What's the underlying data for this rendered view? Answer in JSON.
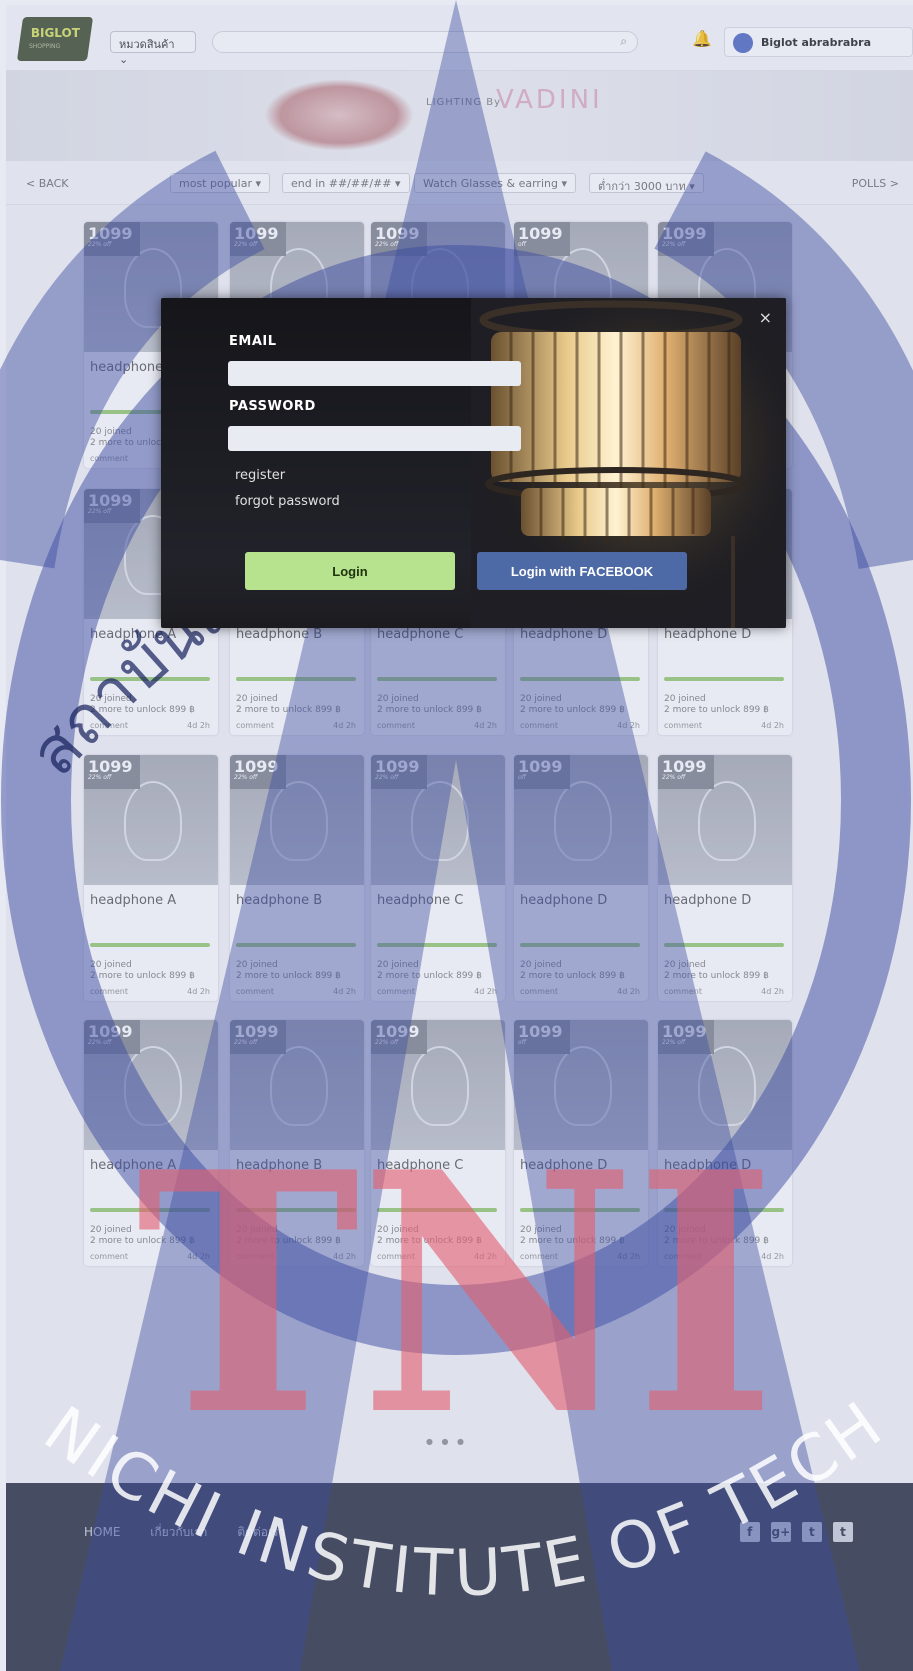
{
  "header": {
    "logo_text": "BIGLOT",
    "logo_sub": "SHOPPING",
    "category_select": "หมวดสินค้า",
    "search_placeholder": "",
    "username": "Biglot abrabrabra"
  },
  "banner": {
    "lighting_text": "LIGHTING By",
    "brand": "VADINI"
  },
  "filters": {
    "back": "< BACK",
    "sort": "most popular",
    "end_date": "end in ##/##/##",
    "category": "Watch Glasses & earring",
    "price": "ต่ำกว่า 3000 บาท",
    "polls": "POLLS >"
  },
  "products": [
    {
      "price": "1099",
      "discount": "22% off",
      "name": "headphone A",
      "joined": "20 joined",
      "unlock": "2 more to unlock 899 ฿",
      "comment": "comment",
      "time": "4d 2h"
    },
    {
      "price": "1099",
      "discount": "22% off",
      "name": "headphone B",
      "joined": "20 joined",
      "unlock": "2 more to unlock 899 ฿",
      "comment": "comment",
      "time": "4d 2h"
    },
    {
      "price": "1099",
      "discount": "22% off",
      "name": "headphone C",
      "joined": "20 joined",
      "unlock": "2 more to unlock 899 ฿",
      "comment": "comment",
      "time": "4d 2h"
    },
    {
      "price": "1099",
      "discount": "off",
      "name": "headphone D",
      "joined": "20 joined",
      "unlock": "2 more to unlock 899 ฿",
      "comment": "comment",
      "time": "4d 2h"
    },
    {
      "price": "1099",
      "discount": "22% off",
      "name": "headphone D",
      "joined": "20 joined",
      "unlock": "2 more to unlock 899 ฿",
      "comment": "comment",
      "time": "4d 2h"
    }
  ],
  "modal": {
    "email_label": "EMAIL",
    "email_value": "",
    "password_label": "PASSWORD",
    "password_value": "",
    "register_link": "register",
    "forgot_link": "forgot password",
    "login_button": "Login",
    "facebook_button": "Login with FACEBOOK",
    "close_icon": "×"
  },
  "footer": {
    "nav": [
      "HOME",
      "เกี่ยวกับเรา",
      "ติดต่อเรา"
    ],
    "social": [
      "f",
      "g+",
      "t",
      "t"
    ]
  },
  "watermark": {
    "tni": "TNI",
    "institute": "NICHI INSTITUTE OF TECH",
    "thai": "สถาบันเทคโนโลยีไทย"
  },
  "colors": {
    "login_green": "#b8e38e",
    "facebook_blue": "#4e6aa6",
    "watermark_red": "#e26070",
    "watermark_blue": "#3c4ca0"
  }
}
